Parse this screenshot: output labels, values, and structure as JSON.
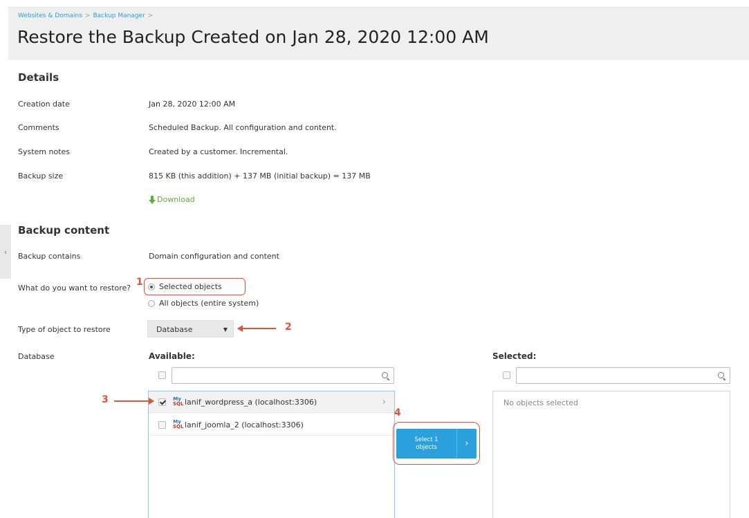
{
  "breadcrumb": [
    "Websites & Domains",
    "Backup Manager"
  ],
  "breadcrumb_sep": ">",
  "title": "Restore the Backup Created on Jan 28, 2020 12:00 AM",
  "details": {
    "heading": "Details",
    "rows": [
      {
        "label": "Creation date",
        "value": "Jan 28, 2020 12:00 AM"
      },
      {
        "label": "Comments",
        "value": "Scheduled Backup. All configuration and content."
      },
      {
        "label": "System notes",
        "value": "Created by a customer. Incremental."
      },
      {
        "label": "Backup size",
        "value": "815 KB (this addition) + 137 MB (initial backup) = 137 MB"
      }
    ],
    "download_label": "Download"
  },
  "content": {
    "heading": "Backup content",
    "contains_label": "Backup contains",
    "contains_value": "Domain configuration and content",
    "restore_label": "What do you want to restore?",
    "restore_options": [
      {
        "label": "Selected objects",
        "checked": true
      },
      {
        "label": "All objects (entire system)",
        "checked": false
      }
    ],
    "type_label": "Type of object to restore",
    "type_value": "Database",
    "database_label": "Database",
    "available_label": "Available:",
    "selected_label": "Selected:",
    "available_items": [
      {
        "label": "lanif_wordpress_a (localhost:3306)",
        "checked": true
      },
      {
        "label": "lanif_joomla_2 (localhost:3306)",
        "checked": false
      }
    ],
    "selected_empty": "No objects selected",
    "select_button_line1": "Select 1",
    "select_button_line2": "objects"
  },
  "annotations": [
    "1",
    "2",
    "3",
    "4"
  ],
  "icons": {
    "db_top": "My",
    "db_bottom": "SQL"
  },
  "colors": {
    "link": "#29a0d8",
    "accent": "#2aa0dc",
    "annotation": "#e0533b",
    "download": "#5fae38"
  }
}
